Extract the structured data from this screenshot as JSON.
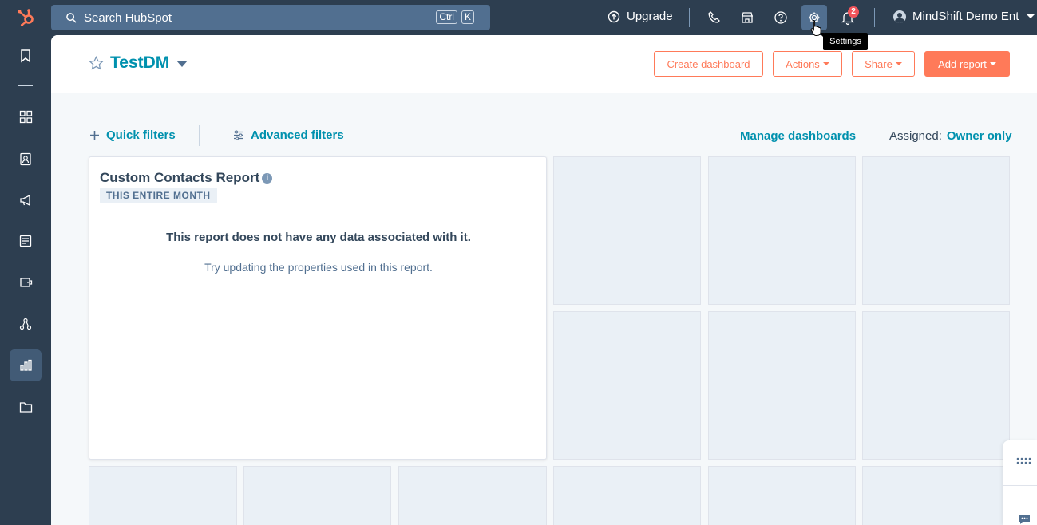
{
  "topbar": {
    "search_placeholder": "Search HubSpot",
    "shortcut_keys": [
      "Ctrl",
      "K"
    ],
    "upgrade_label": "Upgrade",
    "notification_count": "2",
    "account_name": "MindShift Demo Ent",
    "tooltip": "Settings"
  },
  "sidebar": {
    "items": [
      "bookmark-icon",
      "apps-grid-icon",
      "contacts-icon",
      "marketing-megaphone-icon",
      "content-icon",
      "commerce-wallet-icon",
      "automation-icon",
      "reports-icon",
      "library-folder-icon"
    ],
    "active": "reports-icon"
  },
  "header": {
    "title": "TestDM",
    "buttons": {
      "create_dashboard": "Create dashboard",
      "actions": "Actions",
      "share": "Share",
      "add_report": "Add report"
    }
  },
  "filters": {
    "quick_filters": "Quick filters",
    "advanced_filters": "Advanced filters",
    "manage_dashboards": "Manage dashboards",
    "assigned_label": "Assigned:",
    "assigned_value": "Owner only"
  },
  "report": {
    "title": "Custom Contacts Report",
    "date_tag": "THIS ENTIRE MONTH",
    "empty_title": "This report does not have any data associated with it.",
    "empty_subtitle": "Try updating the properties used in this report."
  },
  "colors": {
    "nav_bg": "#2d3e50",
    "accent": "#ff7a59",
    "link": "#0091ae"
  }
}
